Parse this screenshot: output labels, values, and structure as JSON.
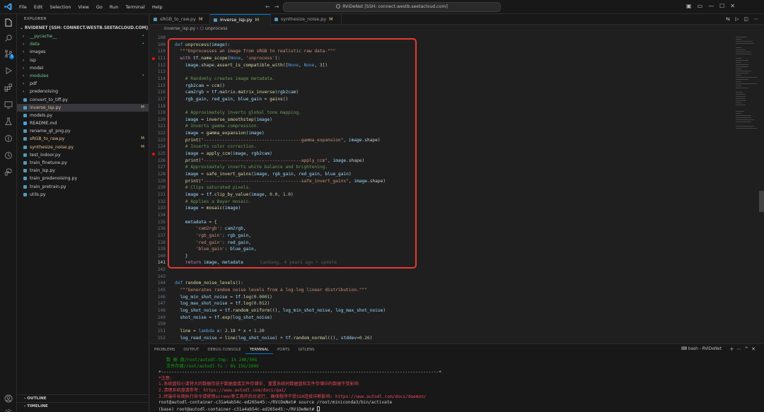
{
  "titlebar": {
    "menus": [
      "File",
      "Edit",
      "Selection",
      "View",
      "Go",
      "Run",
      "Terminal",
      "Help"
    ],
    "search_text": "RViDeNet [SSH: connect.westb.seetacloud.com]"
  },
  "sidebar": {
    "header": "EXPLORER",
    "root": "RVIDENET [SSH: CONNECT.WESTB.SEETACLOUD.COM]",
    "items": [
      {
        "label": "__pycache__",
        "type": "folder",
        "color": "#73c991",
        "dec": "•",
        "dec_color": "#73c991"
      },
      {
        "label": "data",
        "type": "folder",
        "color": "#73c991",
        "dec": "•",
        "dec_color": "#73c991"
      },
      {
        "label": "images",
        "type": "folder",
        "color": "#cccccc",
        "dec": ""
      },
      {
        "label": "isp",
        "type": "folder",
        "color": "#cccccc",
        "dec": ""
      },
      {
        "label": "model",
        "type": "folder",
        "color": "#cccccc",
        "dec": ""
      },
      {
        "label": "modules",
        "type": "folder",
        "color": "#73c991",
        "dec": "•",
        "dec_color": "#73c991"
      },
      {
        "label": "pdf",
        "type": "folder",
        "color": "#cccccc",
        "dec": ""
      },
      {
        "label": "predenoising",
        "type": "folder",
        "color": "#cccccc",
        "dec": ""
      },
      {
        "label": "convert_to_tiff.py",
        "type": "file",
        "color": "#cccccc",
        "dec": ""
      },
      {
        "label": "inverse_isp.py",
        "type": "file",
        "color": "#e2c08d",
        "dec": "M",
        "dec_color": "#e2c08d",
        "selected": true
      },
      {
        "label": "models.py",
        "type": "file",
        "color": "#cccccc",
        "dec": ""
      },
      {
        "label": "README.md",
        "type": "file",
        "color": "#cccccc",
        "dec": ""
      },
      {
        "label": "rename_gt_png.py",
        "type": "file",
        "color": "#cccccc",
        "dec": ""
      },
      {
        "label": "sRGB_to_raw.py",
        "type": "file",
        "color": "#e2c08d",
        "dec": "M",
        "dec_color": "#e2c08d"
      },
      {
        "label": "synthesize_noise.py",
        "type": "file",
        "color": "#e2c08d",
        "dec": "M",
        "dec_color": "#e2c08d"
      },
      {
        "label": "test_indoor.py",
        "type": "file",
        "color": "#cccccc",
        "dec": ""
      },
      {
        "label": "train_finetune.py",
        "type": "file",
        "color": "#cccccc",
        "dec": ""
      },
      {
        "label": "train_isp.py",
        "type": "file",
        "color": "#cccccc",
        "dec": ""
      },
      {
        "label": "train_predenoising.py",
        "type": "file",
        "color": "#cccccc",
        "dec": ""
      },
      {
        "label": "train_pretrain.py",
        "type": "file",
        "color": "#cccccc",
        "dec": ""
      },
      {
        "label": "utils.py",
        "type": "file",
        "color": "#cccccc",
        "dec": ""
      }
    ],
    "outline": "OUTLINE",
    "timeline": "TIMELINE"
  },
  "tabs": [
    {
      "label": "sRGB_to_raw.py",
      "mark": "M",
      "active": false
    },
    {
      "label": "inverse_isp.py",
      "mark": "M",
      "active": true
    },
    {
      "label": "synthesize_noise.py",
      "mark": "M",
      "active": false
    }
  ],
  "breadcrumb": {
    "file": "inverse_isp.py",
    "symbol": "unprocess"
  },
  "code_lines": [
    {
      "n": "108",
      "t": []
    },
    {
      "n": "109",
      "t": [
        [
          "def ",
          "kw2"
        ],
        [
          "unprocess",
          "fn"
        ],
        [
          "(",
          ""
        ],
        [
          "image",
          "var"
        ],
        [
          "):",
          ""
        ]
      ]
    },
    {
      "n": "110",
      "t": [
        [
          "  \"\"\"Unprocesses an image from sRGB to realistic raw data.\"\"\"",
          "str"
        ]
      ]
    },
    {
      "n": "111",
      "t": [
        [
          "  with ",
          "kw"
        ],
        [
          "tf",
          "var"
        ],
        [
          ".",
          ""
        ],
        [
          "name_scope",
          "fn"
        ],
        [
          "(",
          ""
        ],
        [
          "None",
          "kw2"
        ],
        [
          ", ",
          ""
        ],
        [
          "'unprocess'",
          "str"
        ],
        [
          "):",
          ""
        ]
      ],
      "bp": true
    },
    {
      "n": "112",
      "t": [
        [
          "    image",
          "var"
        ],
        [
          ".shape.",
          ""
        ],
        [
          "assert_is_compatible_with",
          "fn"
        ],
        [
          "([",
          ""
        ],
        [
          "None",
          "kw2"
        ],
        [
          ", ",
          ""
        ],
        [
          "None",
          "kw2"
        ],
        [
          ", ",
          ""
        ],
        [
          "3",
          "num"
        ],
        [
          "])",
          ""
        ]
      ]
    },
    {
      "n": "113",
      "t": []
    },
    {
      "n": "114",
      "t": [
        [
          "    # Randomly creates image metadata.",
          "cm"
        ]
      ]
    },
    {
      "n": "115",
      "t": [
        [
          "    rgb2cam",
          "var"
        ],
        [
          " = ",
          ""
        ],
        [
          "ccm",
          "fn"
        ],
        [
          "()",
          ""
        ]
      ]
    },
    {
      "n": "116",
      "t": [
        [
          "    cam2rgb",
          "var"
        ],
        [
          " = ",
          ""
        ],
        [
          "tf",
          "var"
        ],
        [
          ".matrix.",
          ""
        ],
        [
          "matrix_inverse",
          "fn"
        ],
        [
          "(",
          ""
        ],
        [
          "rgb2cam",
          "var"
        ],
        [
          ")",
          ""
        ]
      ]
    },
    {
      "n": "117",
      "t": [
        [
          "    rgb_gain",
          "var"
        ],
        [
          ", ",
          ""
        ],
        [
          "red_gain",
          "var"
        ],
        [
          ", ",
          ""
        ],
        [
          "blue_gain",
          "var"
        ],
        [
          " = ",
          ""
        ],
        [
          "gains",
          "fn"
        ],
        [
          "()",
          ""
        ]
      ]
    },
    {
      "n": "118",
      "t": []
    },
    {
      "n": "119",
      "t": [
        [
          "    # Approximately inverts global tone mapping.",
          "cm"
        ]
      ]
    },
    {
      "n": "120",
      "t": [
        [
          "    image",
          "var"
        ],
        [
          " = ",
          ""
        ],
        [
          "inverse_smoothstep",
          "fn"
        ],
        [
          "(",
          ""
        ],
        [
          "image",
          "var"
        ],
        [
          ")",
          ""
        ]
      ]
    },
    {
      "n": "121",
      "t": [
        [
          "    # Inverts gamma compression.",
          "cm"
        ]
      ]
    },
    {
      "n": "122",
      "t": [
        [
          "    image",
          "var"
        ],
        [
          " = ",
          ""
        ],
        [
          "gamma_expansion",
          "fn"
        ],
        [
          "(",
          ""
        ],
        [
          "image",
          "var"
        ],
        [
          ")",
          ""
        ]
      ]
    },
    {
      "n": "123",
      "t": [
        [
          "    print",
          "fn"
        ],
        [
          "(",
          ""
        ],
        [
          "\"-------------------------------------gamma_expansion\"",
          "str"
        ],
        [
          ", ",
          ""
        ],
        [
          "image",
          "var"
        ],
        [
          ".shape)",
          ""
        ]
      ]
    },
    {
      "n": "124",
      "t": [
        [
          "    # Inverts color correction.",
          "cm"
        ]
      ]
    },
    {
      "n": "125",
      "t": [
        [
          "    image",
          "var"
        ],
        [
          " = ",
          ""
        ],
        [
          "apply_ccm",
          "fn"
        ],
        [
          "(",
          ""
        ],
        [
          "image",
          "var"
        ],
        [
          ", ",
          ""
        ],
        [
          "rgb2cam",
          "var"
        ],
        [
          ")",
          ""
        ]
      ],
      "bp": true
    },
    {
      "n": "126",
      "t": [
        [
          "    print",
          "fn"
        ],
        [
          "(",
          ""
        ],
        [
          "\"-------------------------------------apply_ccm\"",
          "str"
        ],
        [
          ", ",
          ""
        ],
        [
          "image",
          "var"
        ],
        [
          ".shape)",
          ""
        ]
      ]
    },
    {
      "n": "127",
      "t": [
        [
          "    # Approximately inverts white balance and brightening.",
          "cm"
        ]
      ]
    },
    {
      "n": "128",
      "t": [
        [
          "    image",
          "var"
        ],
        [
          " = ",
          ""
        ],
        [
          "safe_invert_gains",
          "fn"
        ],
        [
          "(",
          ""
        ],
        [
          "image",
          "var"
        ],
        [
          ", ",
          ""
        ],
        [
          "rgb_gain",
          "var"
        ],
        [
          ", ",
          ""
        ],
        [
          "red_gain",
          "var"
        ],
        [
          ", ",
          ""
        ],
        [
          "blue_gain",
          "var"
        ],
        [
          ")",
          ""
        ]
      ]
    },
    {
      "n": "129",
      "t": [
        [
          "    print",
          "fn"
        ],
        [
          "(",
          ""
        ],
        [
          "\"-------------------------------------safe_invert_gains\"",
          "str"
        ],
        [
          ", ",
          ""
        ],
        [
          "image",
          "var"
        ],
        [
          ".shape)",
          ""
        ]
      ]
    },
    {
      "n": "130",
      "t": [
        [
          "    # Clips saturated pixels.",
          "cm"
        ]
      ]
    },
    {
      "n": "131",
      "t": [
        [
          "    image",
          "var"
        ],
        [
          " = ",
          ""
        ],
        [
          "tf",
          "var"
        ],
        [
          ".",
          ""
        ],
        [
          "clip_by_value",
          "fn"
        ],
        [
          "(",
          ""
        ],
        [
          "image",
          "var"
        ],
        [
          ", ",
          ""
        ],
        [
          "0.0",
          "num"
        ],
        [
          ", ",
          ""
        ],
        [
          "1.0",
          "num"
        ],
        [
          ")",
          ""
        ]
      ]
    },
    {
      "n": "132",
      "t": [
        [
          "    # Applies a Bayer mosaic.",
          "cm"
        ]
      ]
    },
    {
      "n": "133",
      "t": [
        [
          "    image",
          "var"
        ],
        [
          " = ",
          ""
        ],
        [
          "mosaic",
          "fn"
        ],
        [
          "(",
          ""
        ],
        [
          "image",
          "var"
        ],
        [
          ")",
          ""
        ]
      ]
    },
    {
      "n": "134",
      "t": []
    },
    {
      "n": "135",
      "t": [
        [
          "    metadata",
          "var"
        ],
        [
          " = {",
          ""
        ]
      ]
    },
    {
      "n": "136",
      "t": [
        [
          "        'cam2rgb'",
          "str"
        ],
        [
          ": ",
          ""
        ],
        [
          "cam2rgb",
          "var"
        ],
        [
          ",",
          ""
        ]
      ]
    },
    {
      "n": "137",
      "t": [
        [
          "        'rgb_gain'",
          "str"
        ],
        [
          ": ",
          ""
        ],
        [
          "rgb_gain",
          "var"
        ],
        [
          ",",
          ""
        ]
      ]
    },
    {
      "n": "138",
      "t": [
        [
          "        'red_gain'",
          "str"
        ],
        [
          ": ",
          ""
        ],
        [
          "red_gain",
          "var"
        ],
        [
          ",",
          ""
        ]
      ]
    },
    {
      "n": "139",
      "t": [
        [
          "        'blue_gain'",
          "str"
        ],
        [
          ": ",
          ""
        ],
        [
          "blue_gain",
          "var"
        ],
        [
          ",",
          ""
        ]
      ]
    },
    {
      "n": "140",
      "t": [
        [
          "    }",
          ""
        ]
      ]
    },
    {
      "n": "141",
      "t": [
        [
          "    return ",
          "kw"
        ],
        [
          "image",
          "var"
        ],
        [
          ", ",
          ""
        ],
        [
          "metadata",
          "var"
        ]
      ],
      "blame": "CaoGang, 4 years ago • update",
      "cur": true
    },
    {
      "n": "142",
      "t": []
    },
    {
      "n": "143",
      "t": []
    },
    {
      "n": "144",
      "t": [
        [
          "def ",
          "kw2"
        ],
        [
          "random_noise_levels",
          "fn"
        ],
        [
          "():",
          ""
        ]
      ]
    },
    {
      "n": "145",
      "t": [
        [
          "  \"\"\"Generates random noise levels from a log-log linear distribution.\"\"\"",
          "str"
        ]
      ]
    },
    {
      "n": "146",
      "t": [
        [
          "  log_min_shot_noise",
          "var"
        ],
        [
          " = ",
          ""
        ],
        [
          "tf",
          "var"
        ],
        [
          ".",
          ""
        ],
        [
          "log",
          "fn"
        ],
        [
          "(",
          ""
        ],
        [
          "0.0001",
          "num"
        ],
        [
          ")",
          ""
        ]
      ]
    },
    {
      "n": "147",
      "t": [
        [
          "  log_max_shot_noise",
          "var"
        ],
        [
          " = ",
          ""
        ],
        [
          "tf",
          "var"
        ],
        [
          ".",
          ""
        ],
        [
          "log",
          "fn"
        ],
        [
          "(",
          ""
        ],
        [
          "0.012",
          "num"
        ],
        [
          ")",
          ""
        ]
      ]
    },
    {
      "n": "148",
      "t": [
        [
          "  log_shot_noise",
          "var"
        ],
        [
          " = ",
          ""
        ],
        [
          "tf",
          "var"
        ],
        [
          ".",
          ""
        ],
        [
          "random_uniform",
          "fn"
        ],
        [
          "((), ",
          ""
        ],
        [
          "log_min_shot_noise",
          "var"
        ],
        [
          ", ",
          ""
        ],
        [
          "log_max_shot_noise",
          "var"
        ],
        [
          ")",
          ""
        ]
      ]
    },
    {
      "n": "149",
      "t": [
        [
          "  shot_noise",
          "var"
        ],
        [
          " = ",
          ""
        ],
        [
          "tf",
          "var"
        ],
        [
          ".",
          ""
        ],
        [
          "exp",
          "fn"
        ],
        [
          "(",
          ""
        ],
        [
          "log_shot_noise",
          "var"
        ],
        [
          ")",
          ""
        ]
      ]
    },
    {
      "n": "150",
      "t": []
    },
    {
      "n": "151",
      "t": [
        [
          "  line",
          "fn"
        ],
        [
          " = ",
          ""
        ],
        [
          "lambda ",
          "kw2"
        ],
        [
          "x",
          "var"
        ],
        [
          ": ",
          ""
        ],
        [
          "2.18",
          "num"
        ],
        [
          " * ",
          ""
        ],
        [
          "x",
          "var"
        ],
        [
          " + ",
          ""
        ],
        [
          "1.20",
          "num"
        ]
      ]
    },
    {
      "n": "152",
      "t": [
        [
          "  log_read_noise",
          "var"
        ],
        [
          " = ",
          ""
        ],
        [
          "line",
          "fn"
        ],
        [
          "(",
          ""
        ],
        [
          "log_shot_noise",
          "var"
        ],
        [
          ") + ",
          ""
        ],
        [
          "tf",
          "var"
        ],
        [
          ".",
          ""
        ],
        [
          "random_normal",
          "fn"
        ],
        [
          "((), ",
          ""
        ],
        [
          "stddev",
          "var"
        ],
        [
          "=",
          ""
        ],
        [
          "0.26",
          "num"
        ],
        [
          ")",
          ""
        ]
      ]
    }
  ],
  "panel": {
    "tabs": [
      "PROBLEMS",
      "OUTPUT",
      "DEBUG CONSOLE",
      "TERMINAL",
      "PORTS",
      "GITLENS"
    ],
    "active_tab": "TERMINAL",
    "terminal_name": "bash - RViDeNet",
    "terminal_lines": [
      {
        "text": "   数 据 盘/root/autodl-tmp: 1% 24K/50G",
        "cls": "tg"
      },
      {
        "text": "   文件存储/root/autodl-fs : 8% 15G/200G",
        "cls": "tg"
      },
      {
        "text": "+-----------------------------------------------------------------------------------------------------------+",
        "cls": "tw"
      },
      {
        "text": "*注意:",
        "cls": "tr"
      },
      {
        "text": "1.系统盘较小请将大的数据存放于数据盘或文件存储中, 重置系统时数据盘和文件存储中的数据不受影响",
        "cls": "tr"
      },
      {
        "text": "2.清理系统盘请参考: https://www.autodl.com/docs/qa1/",
        "cls": "tr"
      },
      {
        "text": "3.终端中长期执行命令请使用screen等工具开后台运行, 确保程序不受SSH连接中断影响: https://www.autodl.com/docs/daemon/",
        "cls": "tr"
      },
      {
        "text": "root@autodl-container-c31a4ab54c-ed265e45:~/RViDeNet# source /root/miniconda3/bin/activate",
        "cls": "tw"
      },
      {
        "text": "(base) root@autodl-container-c31a4ab54c-ed265e45:~/RViDeNet# ",
        "cls": "tw",
        "cursor": true
      }
    ]
  },
  "accent_color": "#0078d4",
  "highlight_box_color": "#e53935"
}
